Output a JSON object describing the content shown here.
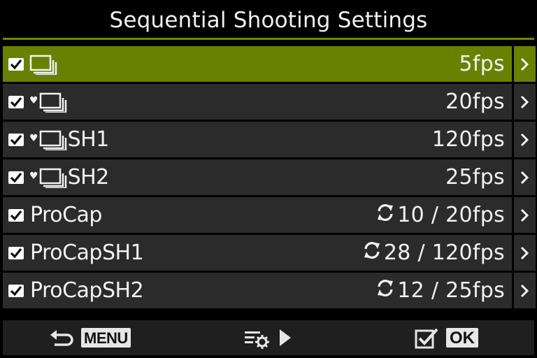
{
  "header": {
    "title": "Sequential Shooting Settings"
  },
  "rows": [
    {
      "checked": true,
      "mode_icon": "sequential-shooting-icon",
      "heart": "",
      "suffix": "",
      "value": "5fps",
      "loop_icon": false,
      "selected": true
    },
    {
      "checked": true,
      "mode_icon": "silent-sequential-shooting-icon",
      "heart": "♥",
      "suffix": "",
      "value": "20fps",
      "loop_icon": false,
      "selected": false
    },
    {
      "checked": true,
      "mode_icon": "silent-sequential-shooting-icon",
      "heart": "♥",
      "suffix": "SH1",
      "value": "120fps",
      "loop_icon": false,
      "selected": false
    },
    {
      "checked": true,
      "mode_icon": "silent-sequential-shooting-icon",
      "heart": "♥",
      "suffix": "SH2",
      "value": "25fps",
      "loop_icon": false,
      "selected": false
    },
    {
      "checked": true,
      "mode_icon": "",
      "heart": "",
      "suffix": "ProCap",
      "value": "10 / 20fps",
      "loop_icon": true,
      "selected": false
    },
    {
      "checked": true,
      "mode_icon": "",
      "heart": "",
      "suffix": "ProCapSH1",
      "value": "28 / 120fps",
      "loop_icon": true,
      "selected": false
    },
    {
      "checked": true,
      "mode_icon": "",
      "heart": "",
      "suffix": "ProCapSH2",
      "value": "12 / 25fps",
      "loop_icon": true,
      "selected": false
    }
  ],
  "footer": {
    "back": {
      "icon": "return-arrow-icon",
      "label": "MENU"
    },
    "settings": {
      "icon": "settings-list-icon",
      "arrow_icon": "play-right-icon"
    },
    "confirm": {
      "icon": "checkbox-icon",
      "label": "OK"
    }
  },
  "colors": {
    "selected_row": "#6a8000",
    "row": "#2b2b2b",
    "title_rule": "#6d8a00",
    "background": "#000000"
  }
}
